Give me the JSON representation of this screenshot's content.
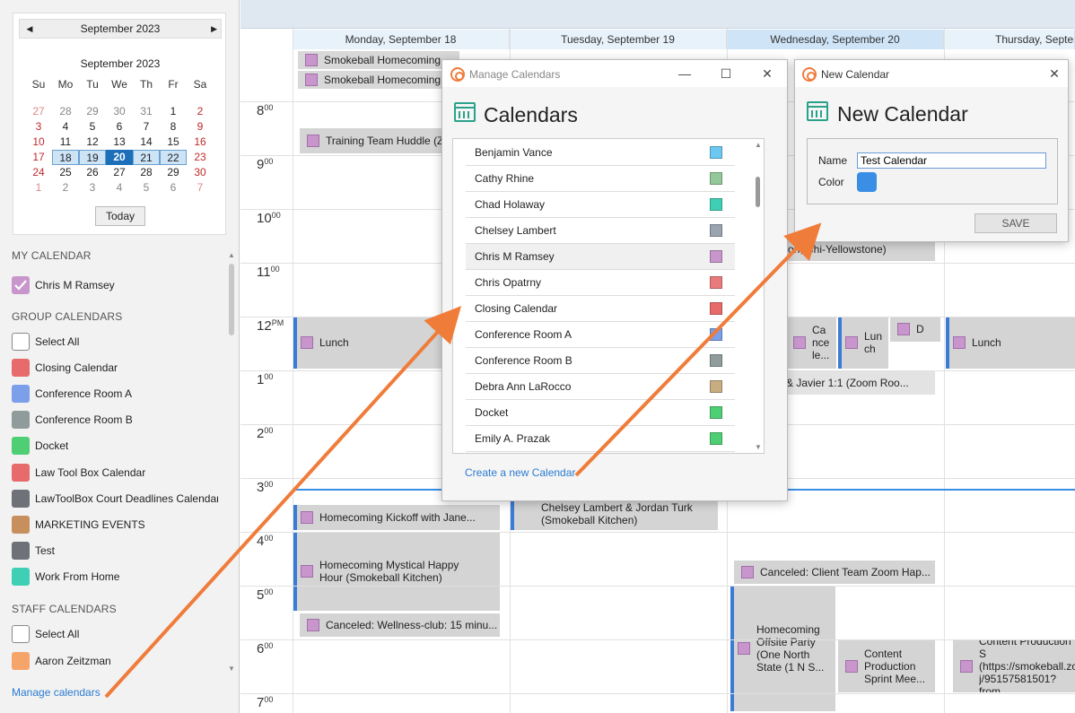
{
  "sidebar": {
    "minical": {
      "header_month": "September 2023",
      "prev": "◀",
      "next": "▶",
      "title": "September 2023",
      "dow": [
        "Su",
        "Mo",
        "Tu",
        "We",
        "Th",
        "Fr",
        "Sa"
      ],
      "weeks": [
        [
          "27",
          "28",
          "29",
          "30",
          "31",
          "1",
          "2"
        ],
        [
          "3",
          "4",
          "5",
          "6",
          "7",
          "8",
          "9"
        ],
        [
          "10",
          "11",
          "12",
          "13",
          "14",
          "15",
          "16"
        ],
        [
          "17",
          "18",
          "19",
          "20",
          "21",
          "22",
          "23"
        ],
        [
          "24",
          "25",
          "26",
          "27",
          "28",
          "29",
          "30"
        ],
        [
          "1",
          "2",
          "3",
          "4",
          "5",
          "6",
          "7"
        ]
      ],
      "today_label": "Today"
    },
    "my_calendar_title": "MY CALENDAR",
    "my_calendar": [
      {
        "label": "Chris M Ramsey",
        "color": "#c896cc",
        "checked": true
      }
    ],
    "group_calendars_title": "GROUP CALENDARS",
    "group_calendars": [
      {
        "label": "Select All",
        "color": "#ffffff"
      },
      {
        "label": "Closing Calendar",
        "color": "#e86b6b"
      },
      {
        "label": "Conference Room A",
        "color": "#7b9fe8"
      },
      {
        "label": "Conference Room B",
        "color": "#909c9c"
      },
      {
        "label": "Docket",
        "color": "#4fcf74"
      },
      {
        "label": "Law Tool Box Calendar",
        "color": "#e86b6b"
      },
      {
        "label": "LawToolBox Court Deadlines Calendar",
        "color": "#6e7178"
      },
      {
        "label": "MARKETING EVENTS",
        "color": "#c88f5e"
      },
      {
        "label": "Test",
        "color": "#6e7178"
      },
      {
        "label": "Work From Home",
        "color": "#3fcfb4"
      }
    ],
    "staff_calendars_title": "STAFF CALENDARS",
    "staff_calendars": [
      {
        "label": "Select All",
        "color": "#ffffff"
      },
      {
        "label": "Aaron Zeitzman",
        "color": "#f6a56a"
      }
    ],
    "manage_link": "Manage calendars"
  },
  "calendar": {
    "days": [
      "Monday, September 18",
      "Tuesday, September 19",
      "Wednesday, September 20",
      "Thursday, Septer"
    ],
    "times": [
      {
        "h": "8",
        "m": "00"
      },
      {
        "h": "9",
        "m": "00"
      },
      {
        "h": "10",
        "m": "00"
      },
      {
        "h": "11",
        "m": "00"
      },
      {
        "h": "12",
        "m": "PM"
      },
      {
        "h": "1",
        "m": "00"
      },
      {
        "h": "2",
        "m": "00"
      },
      {
        "h": "3",
        "m": "00"
      },
      {
        "h": "4",
        "m": "00"
      },
      {
        "h": "5",
        "m": "00"
      },
      {
        "h": "6",
        "m": "00"
      },
      {
        "h": "7",
        "m": "00"
      }
    ],
    "events": {
      "homecoming1": "Smokeball Homecoming",
      "homecoming2": "Smokeball Homecoming",
      "training": "Training Team Huddle  (Z",
      "lunch_mon": "Lunch",
      "kickoff": "Homecoming Kickoff with Jane...",
      "mystical": "Homecoming Mystical Happy Hour   (Smokeball Kitchen)",
      "wellness": "Canceled: Wellness-club: 15 minu...",
      "chelsey": "Chelsey Lambert & Jordan Turk (Smokeball Kitchen)",
      "wed_cancel_lunch": "Ca nce le...",
      "wed_lunch": "Lun ch",
      "wed_d": "D",
      "javier": "& Javier 1:1  (Zoom Roo...",
      "yellowstone": "son; Chi-Yellowstone)",
      "client_team": "Canceled: Client Team Zoom Hap...",
      "offsite": "Homecoming Offsite Party (One North State (1 N S...",
      "content": "Content Production Sprint Mee...",
      "thu_lunch": "Lunch",
      "thu_content": "Content Production S (https://smokeball.zo j/95157581501?from"
    }
  },
  "manage_dialog": {
    "window_title": "Manage Calendars",
    "heading": "Calendars",
    "items": [
      {
        "label": "Benjamin Vance",
        "color": "#6cc8f0"
      },
      {
        "label": "Cathy Rhine",
        "color": "#94c79a"
      },
      {
        "label": "Chad Holaway",
        "color": "#3fcfb4"
      },
      {
        "label": "Chelsey Lambert",
        "color": "#9aa3b0"
      },
      {
        "label": "Chris M Ramsey",
        "color": "#c896cc"
      },
      {
        "label": "Chris Opatrny",
        "color": "#e87c7c"
      },
      {
        "label": "Closing Calendar",
        "color": "#e86b6b"
      },
      {
        "label": "Conference Room A",
        "color": "#7b9fe8"
      },
      {
        "label": "Conference Room B",
        "color": "#909c9c"
      },
      {
        "label": "Debra Ann LaRocco",
        "color": "#c9ad82"
      },
      {
        "label": "Docket",
        "color": "#4fcf74"
      },
      {
        "label": "Emily A. Prazak",
        "color": "#4fcf74"
      }
    ],
    "create_link": "Create a new Calendar",
    "min": "—",
    "max": "☐",
    "close": "✕"
  },
  "new_dialog": {
    "window_title": "New Calendar",
    "heading": "New Calendar",
    "name_label": "Name",
    "name_value": "Test Calendar",
    "color_label": "Color",
    "color_value": "#3a8ee6",
    "save_label": "SAVE",
    "close": "✕"
  },
  "annotation_color": "#f07c3a"
}
